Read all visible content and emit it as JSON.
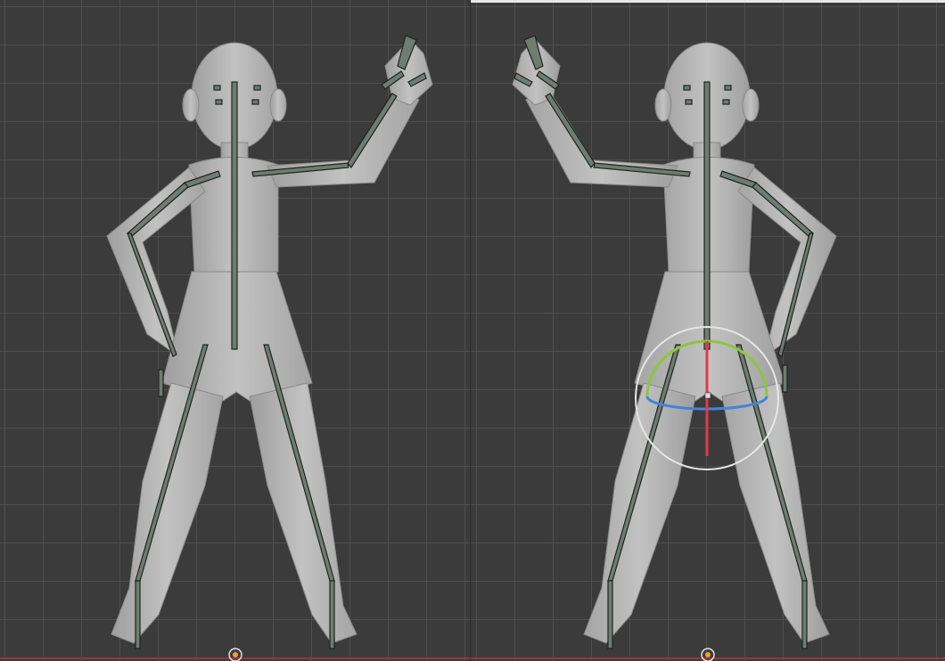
{
  "viewports": {
    "left": {
      "view": "front",
      "name": "left-viewport"
    },
    "right": {
      "view": "back",
      "name": "right-viewport"
    }
  },
  "colors": {
    "background": "#3b3b3b",
    "grid": "#505050",
    "body": "#b9b9b9",
    "bone": "#6f7c72",
    "bone_outline": "#1e2420",
    "x_axis": "#a0303d",
    "gizmo_red": "#e03a4a",
    "gizmo_green": "#8cc63e",
    "gizmo_blue": "#3f86d8",
    "gizmo_circle": "#e6e6e6",
    "origin_orange": "#f0a030"
  },
  "icons": [
    "origin-icon",
    "rotate-gizmo-icon"
  ]
}
